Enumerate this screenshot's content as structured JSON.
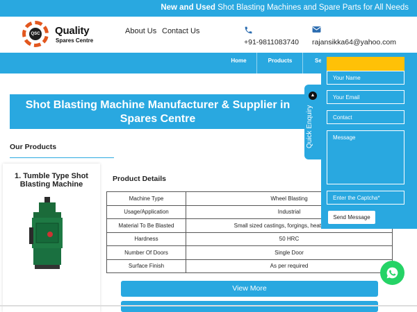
{
  "top_banner": {
    "bold_text": "New and Used",
    "text": "Shot Blasting Machines and Spare Parts for All Needs"
  },
  "logo": {
    "name": "Quality",
    "subtitle": "Spares Centre",
    "mark": "QSC"
  },
  "header_nav": [
    {
      "label": "About Us"
    },
    {
      "label": "Contact Us"
    }
  ],
  "contacts": {
    "phone": "+91-9811083740",
    "email": "rajansikka64@yahoo.com",
    "phone_icon": "phone-icon",
    "email_icon": "envelope-icon"
  },
  "menu": [
    {
      "label": "Home"
    },
    {
      "label": "Products"
    },
    {
      "label": "Se"
    }
  ],
  "hero": {
    "line1": "Shot Blasting Machine Manufacturer & Supplier in",
    "line2": "Spares Centre"
  },
  "section_title": "Our Products",
  "product": {
    "title": "1. Tumble Type Shot Blasting Machine",
    "details_heading": "Product Details",
    "details": [
      {
        "key": "Machine Type",
        "value": "Wheel Blasting"
      },
      {
        "key": "Usage/Application",
        "value": "Industrial"
      },
      {
        "key": "Material To Be Blasted",
        "value": "Small sized castings, forgings, heat treated c"
      },
      {
        "key": "Hardness",
        "value": "50 HRC"
      },
      {
        "key": "Number Of Doors",
        "value": "Single Door"
      },
      {
        "key": "Surface Finish",
        "value": "As per required"
      }
    ],
    "view_more": "View More"
  },
  "enquiry": {
    "tab_label": "Quick Enquiry",
    "name_placeholder": "Your Name",
    "email_placeholder": "Your Email",
    "contact_placeholder": "Contact",
    "message_placeholder": "Message",
    "captcha_placeholder": "Enter the Captcha*",
    "send_label": "Send Message"
  },
  "colors": {
    "accent": "#29a8e0",
    "highlight": "#ffc107",
    "whatsapp": "#25d366"
  },
  "icons": {
    "whatsapp": "whatsapp-icon",
    "collapse": "chevron-up-icon"
  }
}
